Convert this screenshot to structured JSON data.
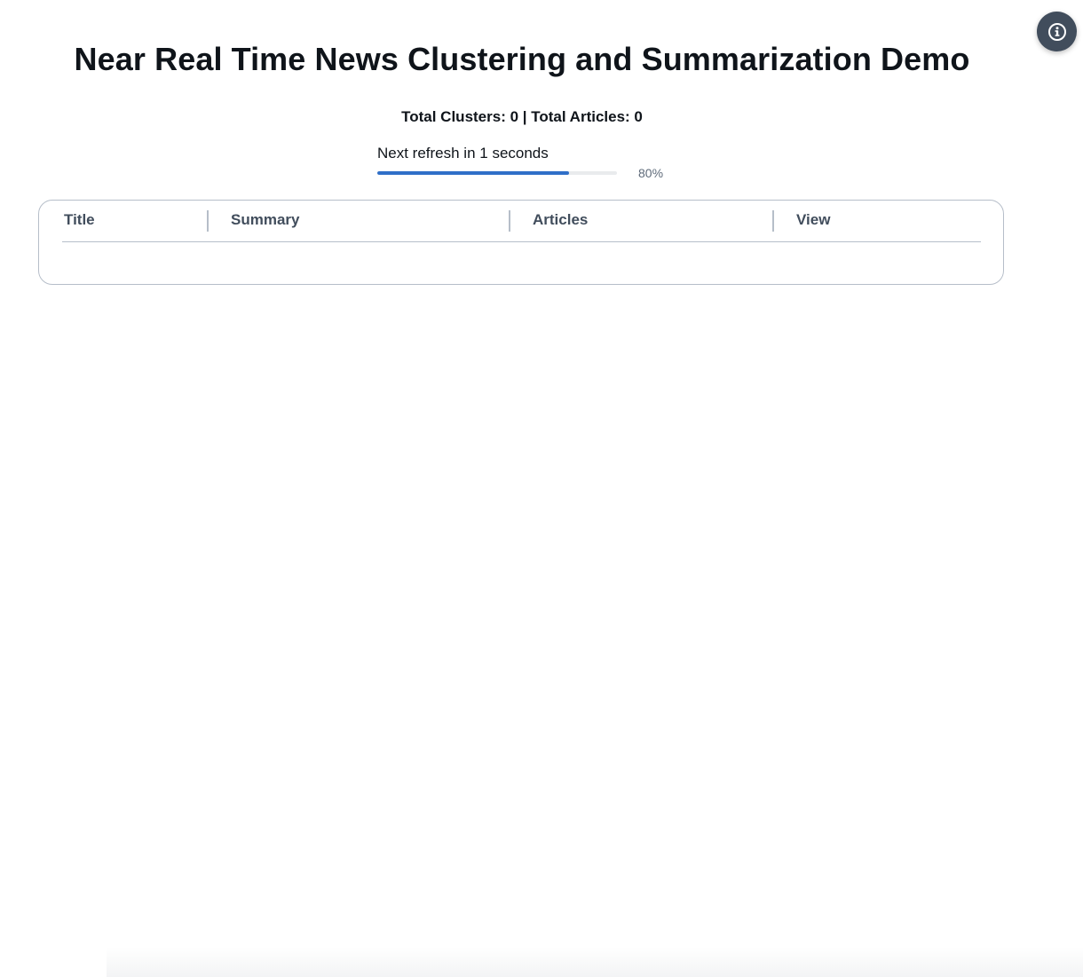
{
  "header": {
    "title": "Near Real Time News Clustering and Summarization Demo"
  },
  "stats": {
    "totals_text": "Total Clusters: 0 | Total Articles: 0"
  },
  "refresh": {
    "label": "Next refresh in 1 seconds",
    "progress_percent": 80,
    "progress_text": "80%"
  },
  "table": {
    "columns": [
      "Title",
      "Summary",
      "Articles",
      "View"
    ],
    "rows": []
  },
  "info_button": {
    "icon": "info-icon"
  },
  "colors": {
    "progress_fill": "#2f6fc8",
    "info_button_bg": "#414d5c"
  }
}
